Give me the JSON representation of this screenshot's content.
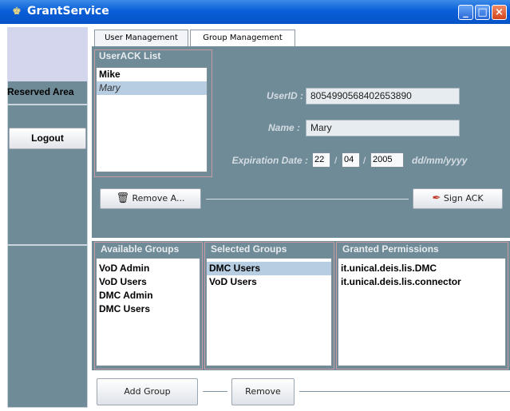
{
  "window": {
    "title": "GrantService",
    "minimize": "_",
    "maximize": "□",
    "close": "×",
    "app_icon": "user-icon"
  },
  "sidebar": {
    "reserved_area": "Reserved Area",
    "logout": "Logout"
  },
  "tabs": [
    {
      "label": "User Management",
      "active": true
    },
    {
      "label": "Group Management",
      "active": false
    }
  ],
  "user_ack": {
    "legend": "UserACK List",
    "items": [
      {
        "label": "Mike",
        "selected": false
      },
      {
        "label": "Mary",
        "selected": true
      }
    ]
  },
  "form": {
    "userid_label": "UserID :",
    "userid_value": "8054990568402653890",
    "name_label": "Name :",
    "name_value": "Mary",
    "expiration_label": "Expiration Date :",
    "day": "22",
    "month": "04",
    "year": "2005",
    "slash": "/",
    "date_format": "dd/mm/yyyy"
  },
  "actions": {
    "remove_ack": "Remove A...",
    "sign_ack": "Sign ACK"
  },
  "groups": {
    "available_legend": "Available Groups",
    "available": [
      "VoD Admin",
      "VoD Users",
      "DMC Admin",
      "DMC Users"
    ],
    "selected_legend": "Selected Groups",
    "selected": [
      {
        "label": "DMC Users",
        "selected": true
      },
      {
        "label": "VoD Users",
        "selected": false
      }
    ],
    "permissions_legend": "Granted Permissions",
    "permissions": [
      "it.unical.deis.lis.DMC",
      "it.unical.deis.lis.connector"
    ]
  },
  "bottom": {
    "add_group": "Add Group",
    "remove": "Remove"
  },
  "colors": {
    "panel": "#6f8b98",
    "title_blue": "#0a5fd8",
    "selection": "#b6cde2",
    "group_border": "#c99aa2"
  }
}
